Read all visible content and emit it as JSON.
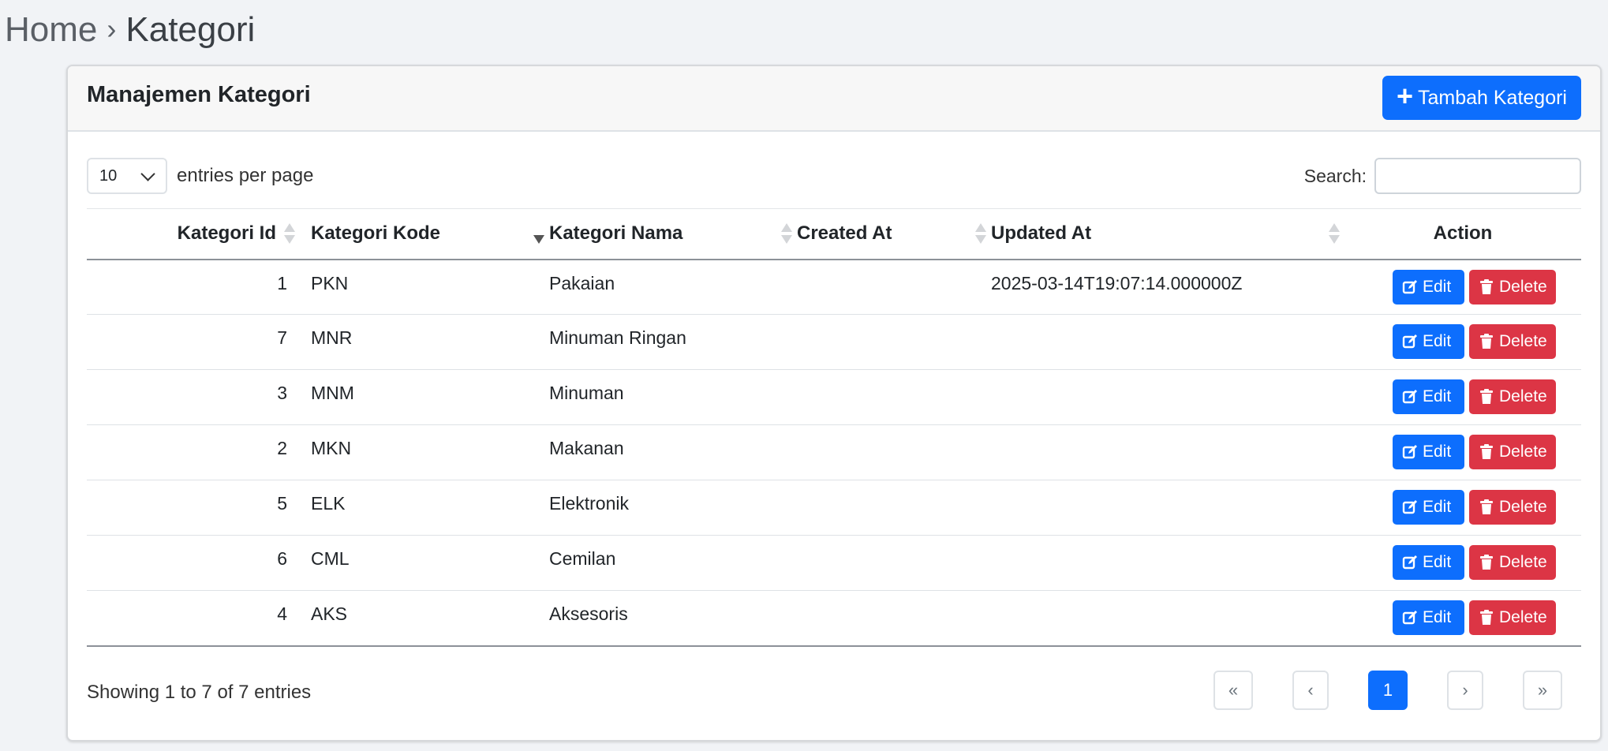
{
  "breadcrumb": {
    "home": "Home",
    "separator": "›",
    "current": "Kategori"
  },
  "card": {
    "title": "Manajemen Kategori",
    "add_button": "Tambah Kategori"
  },
  "controls": {
    "page_size": "10",
    "entries_label": "entries per page",
    "search_label": "Search:",
    "search_value": ""
  },
  "table": {
    "headers": {
      "id": "Kategori Id",
      "kode": "Kategori Kode",
      "nama": "Kategori Nama",
      "created": "Created At",
      "updated": "Updated At",
      "action": "Action"
    },
    "rows": [
      {
        "id": "1",
        "kode": "PKN",
        "nama": "Pakaian",
        "created": "",
        "updated": "2025-03-14T19:07:14.000000Z"
      },
      {
        "id": "7",
        "kode": "MNR",
        "nama": "Minuman Ringan",
        "created": "",
        "updated": ""
      },
      {
        "id": "3",
        "kode": "MNM",
        "nama": "Minuman",
        "created": "",
        "updated": ""
      },
      {
        "id": "2",
        "kode": "MKN",
        "nama": "Makanan",
        "created": "",
        "updated": ""
      },
      {
        "id": "5",
        "kode": "ELK",
        "nama": "Elektronik",
        "created": "",
        "updated": ""
      },
      {
        "id": "6",
        "kode": "CML",
        "nama": "Cemilan",
        "created": "",
        "updated": ""
      },
      {
        "id": "4",
        "kode": "AKS",
        "nama": "Aksesoris",
        "created": "",
        "updated": ""
      }
    ],
    "edit_label": "Edit",
    "delete_label": "Delete"
  },
  "footer": {
    "info": "Showing 1 to 7 of 7 entries",
    "pager": {
      "first": "«",
      "prev": "‹",
      "page": "1",
      "next": "›",
      "last": "»"
    }
  },
  "colors": {
    "primary": "#0d6efd",
    "danger": "#dc3545"
  },
  "icons": {
    "add": "plus-icon",
    "edit": "edit-icon",
    "delete": "trash-icon"
  }
}
